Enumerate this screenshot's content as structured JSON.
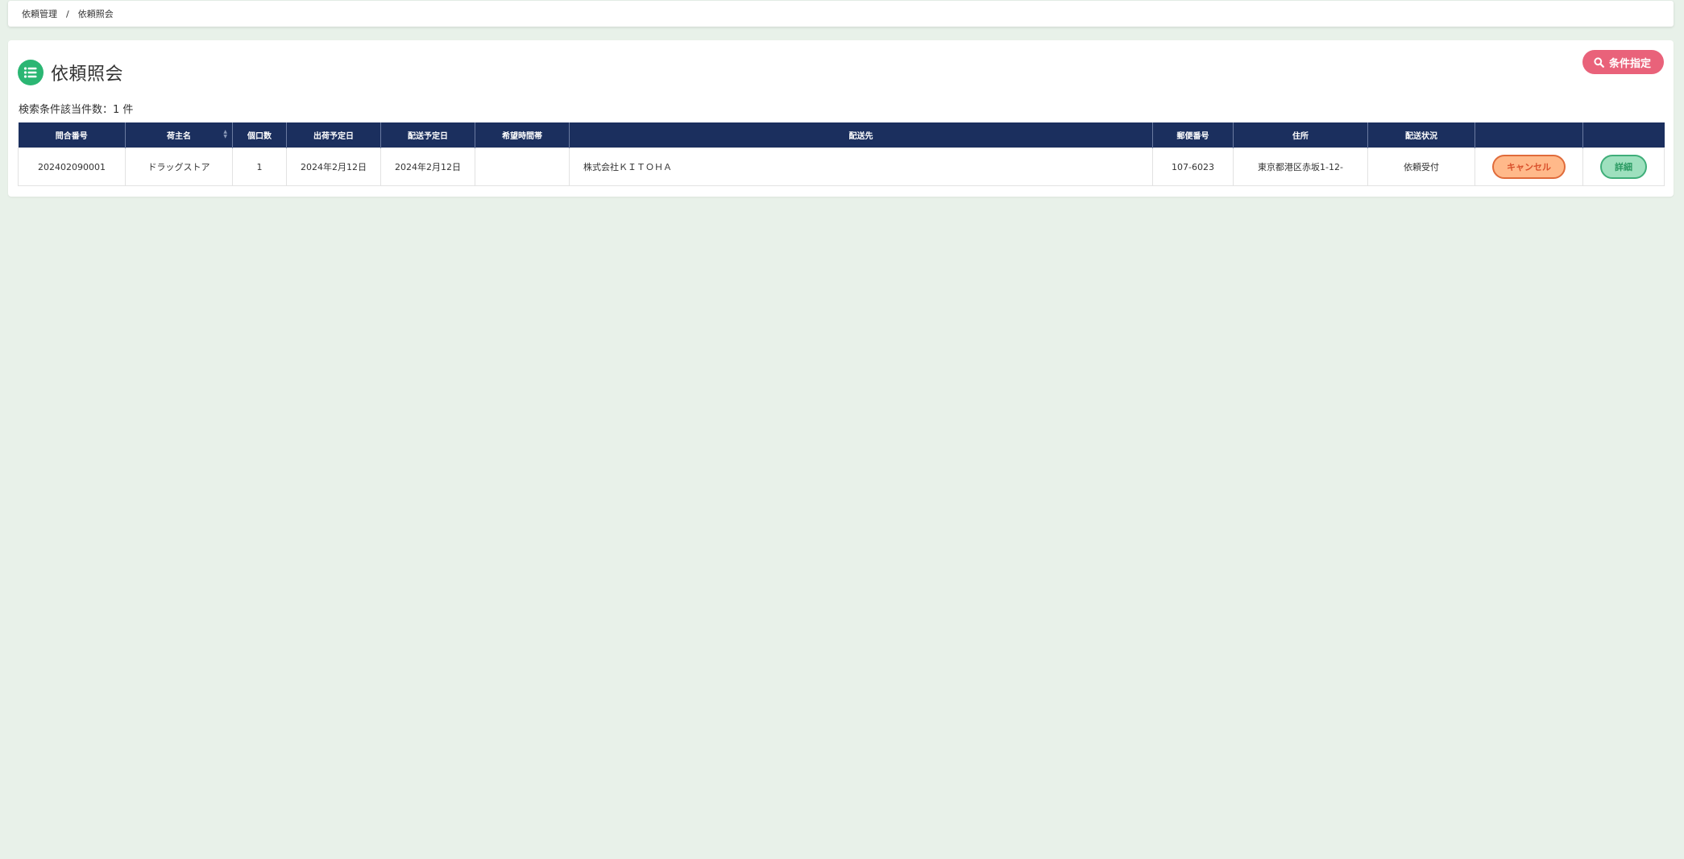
{
  "breadcrumb": {
    "items": [
      "依頼管理",
      "依頼照会"
    ],
    "separator": "/"
  },
  "page": {
    "title": "依頼照会",
    "icon": "list-icon",
    "result_count_text": "検索条件該当件数：1 件"
  },
  "search_button": {
    "label": "条件指定",
    "icon": "search-icon"
  },
  "table": {
    "columns": [
      "問合番号",
      "荷主名",
      "個口数",
      "出荷予定日",
      "配送予定日",
      "希望時間帯",
      "配送先",
      "郵便番号",
      "住所",
      "配送状況",
      "",
      ""
    ],
    "rows": [
      {
        "inquiry_no": "202402090001",
        "shipper": "ドラッグストア",
        "pieces": "1",
        "ship_date": "2024年2月12日",
        "delivery_date": "2024年2月12日",
        "time_slot": "",
        "destination": "株式会社ＫＩＴＯＨＡ",
        "postal_code": "107-6023",
        "address": "東京都港区赤坂1-12-",
        "status": "依頼受付",
        "cancel_label": "キャンセル",
        "detail_label": "詳細"
      }
    ]
  },
  "colors": {
    "background": "#e8f1e9",
    "header": "#1b2f5e",
    "title_icon": "#2bb673",
    "search_button": "#e9627a",
    "cancel_button": "#ffb98a",
    "detail_button": "#9ee0be"
  }
}
